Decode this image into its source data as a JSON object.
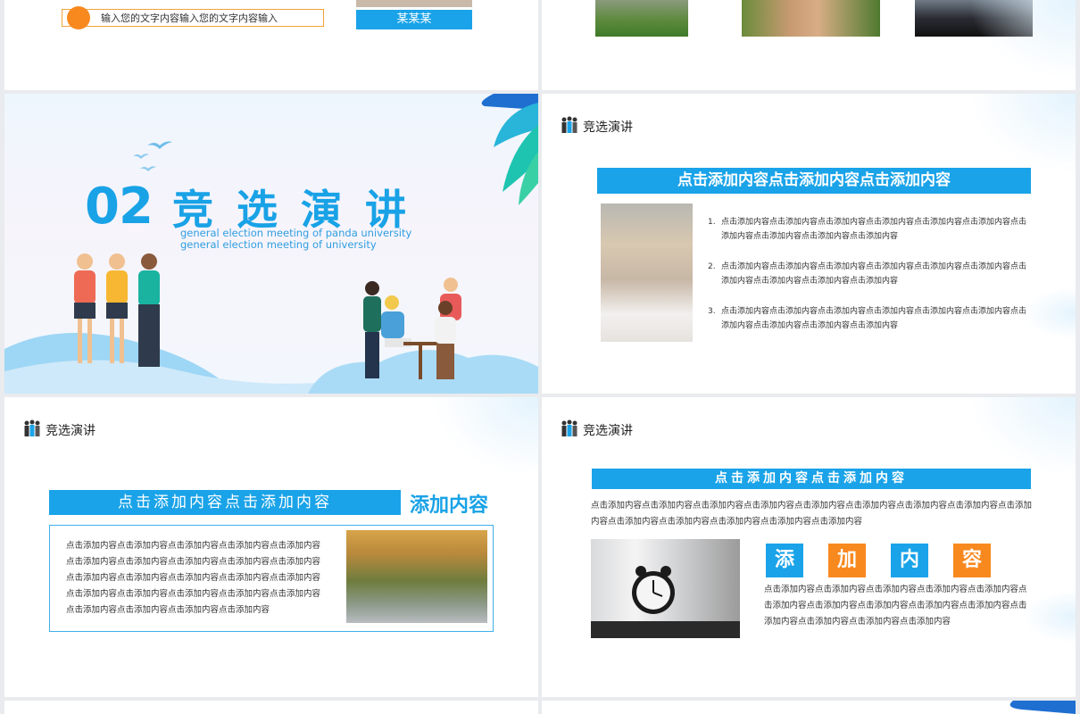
{
  "slide1": {
    "input_text": "输入您的文字内容输入您的文字内容输入",
    "name_label": "某某某"
  },
  "slide3": {
    "number": "02",
    "title": "竞选演讲",
    "subtitle": "general election meeting of panda university general election meeting of university"
  },
  "slide4": {
    "header": "竞选演讲",
    "banner": "点击添加内容点击添加内容点击添加内容",
    "items": [
      {
        "num": "1.",
        "text": "点击添加内容点击添加内容点击添加内容点击添加内容点击添加内容点击添加内容点击添加内容点击添加内容点击添加内容点击添加内容"
      },
      {
        "num": "2.",
        "text": "点击添加内容点击添加内容点击添加内容点击添加内容点击添加内容点击添加内容点击添加内容点击添加内容点击添加内容点击添加内容"
      },
      {
        "num": "3.",
        "text": "点击添加内容点击添加内容点击添加内容点击添加内容点击添加内容点击添加内容点击添加内容点击添加内容点击添加内容点击添加内容"
      }
    ]
  },
  "slide5": {
    "header": "竞选演讲",
    "banner": "点击添加内容点击添加内容",
    "side_title": "添加内容",
    "body": "点击添加内容点击添加内容点击添加内容点击添加内容点击添加内容点击添加内容点击添加内容点击添加内容点击添加内容点击添加内容点击添加内容点击添加内容点击添加内容点击添加内容点击添加内容点击添加内容点击添加内容点击添加内容点击添加内容点击添加内容点击添加内容点击添加内容点击添加内容点击添加内容"
  },
  "slide6": {
    "header": "竞选演讲",
    "banner": "点击添加内容点击添加内容",
    "top_text": "点击添加内容点击添加内容点击添加内容点击添加内容点击添加内容点击添加内容点击添加内容点击添加内容点击添加内容点击添加内容点击添加内容点击添加内容点击添加内容点击添加内容",
    "chars": [
      "添",
      "加",
      "内",
      "容"
    ],
    "body": "点击添加内容点击添加内容点击添加内容点击添加内容点击添加内容点击添加内容点击添加内容点击添加内容点击添加内容点击添加内容点击添加内容点击添加内容点击添加内容点击添加内容"
  },
  "colors": {
    "accent_blue": "#1aa3e8",
    "accent_orange": "#f8891f"
  }
}
